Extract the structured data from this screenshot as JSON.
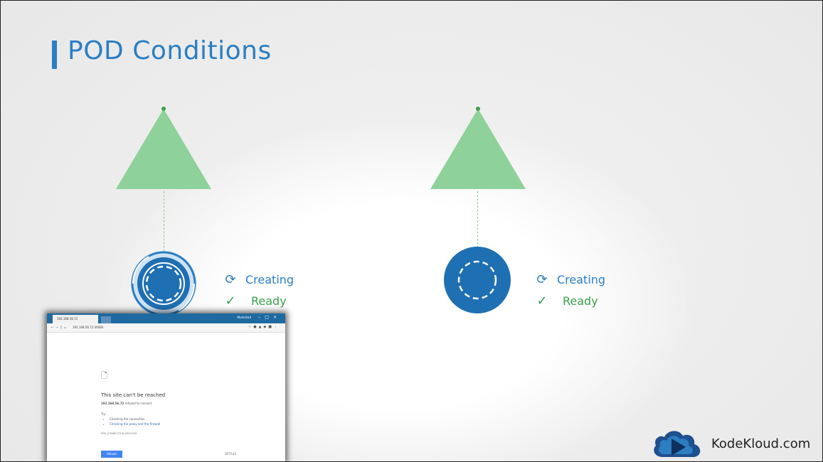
{
  "slide": {
    "title": "POD Conditions",
    "colors": {
      "accent": "#2b7ec2",
      "node": "#8fd19a",
      "ready": "#3aa14a",
      "creating": "#2b7ec2"
    }
  },
  "pods": [
    {
      "statuses": [
        {
          "icon": "refresh-icon",
          "label": "Creating"
        },
        {
          "icon": "check-icon",
          "label": "Ready"
        }
      ]
    },
    {
      "statuses": [
        {
          "icon": "refresh-icon",
          "label": "Creating"
        },
        {
          "icon": "check-icon",
          "label": "Ready"
        }
      ]
    }
  ],
  "browser": {
    "tab_label": "192.168.56.72",
    "user_label": "Mumshad",
    "address": "192.168.56.72:30080",
    "heading": "This site can't be reached",
    "subtext_bold": "192.168.56.72",
    "subtext": "refused to connect.",
    "try_label": "Try:",
    "suggestions": [
      "Checking the connection",
      "Checking the proxy and the firewall"
    ],
    "error_code": "ERR_CONNECTION_REFUSED",
    "reload_label": "Reload",
    "details_label": "DETAILS"
  },
  "branding": {
    "logo_text": "KodeKloud.com"
  }
}
